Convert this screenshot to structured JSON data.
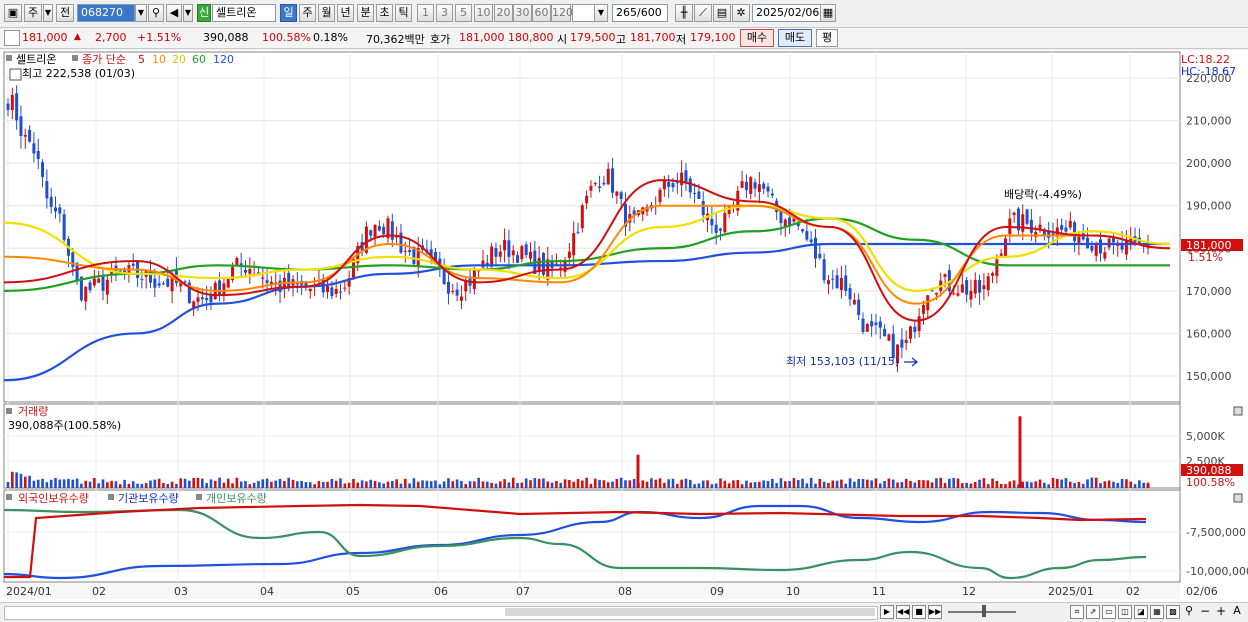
{
  "toolbar": {
    "market": "주",
    "prev_label": "전",
    "code": "068270",
    "stock_name": "셀트리온",
    "new_badge": "신",
    "periods": [
      "일",
      "주",
      "월",
      "년",
      "분",
      "초",
      "틱"
    ],
    "selected_period": "일",
    "intervals": [
      "1",
      "3",
      "5",
      "10",
      "20",
      "30",
      "60",
      "120"
    ],
    "count": "265",
    "count_max": "/600",
    "date": "2025/02/06"
  },
  "info_bar": {
    "price": "181,000",
    "change": "2,700",
    "change_pct": "+1.51%",
    "volume": "390,088",
    "volume_ratio": "100.58%",
    "turnover": "0.18%",
    "amount": "70,362백만",
    "ask_label": "호가",
    "ask_price": "181,000",
    "bid_price": "180,800",
    "open_label": "시",
    "open": "179,500",
    "high_label": "고",
    "high": "181,700",
    "low_label": "저",
    "low": "179,100",
    "buy_label": "매수",
    "sell_label": "매도",
    "eval_label": "평"
  },
  "legend": {
    "name": "셀트리온",
    "ma_label": "종가 단순",
    "ma_periods": [
      "5",
      "10",
      "20",
      "60",
      "120"
    ],
    "ma_colors": [
      "#d01010",
      "#ff8800",
      "#e8d800",
      "#20a020",
      "#2050e0"
    ],
    "high_note": "최고 222,538 (01/03)",
    "low_note": "최저 153,103 (11/15)",
    "dividend_note": "배당락(-4.49%)",
    "lc": "LC:18.22",
    "hc": "HC:-18.67",
    "price_tag": "181,000",
    "pct_tag": "1.51%"
  },
  "volume_panel": {
    "title": "거래량",
    "value_text": "390,088주(100.58%)",
    "tag": "390,088",
    "tag_pct": "100.58%"
  },
  "holding_panel": {
    "items": [
      "외국인보유수량",
      "기관보유수량",
      "개인보유수량"
    ]
  },
  "x_axis": {
    "labels": [
      "2024/01",
      "02",
      "03",
      "04",
      "05",
      "06",
      "07",
      "08",
      "09",
      "10",
      "11",
      "12",
      "2025/01",
      "02",
      "02/06"
    ]
  },
  "colors": {
    "up": "#d01010",
    "down": "#1f4fd0"
  },
  "chart_data": [
    {
      "type": "candlestick",
      "title": "셀트리온",
      "ylabels": [
        "220,000",
        "210,000",
        "200,000",
        "190,000",
        "180,000",
        "170,000",
        "160,000",
        "150,000"
      ],
      "ylim": [
        145000,
        223000
      ],
      "annotations": {
        "high": 222538,
        "high_date": "01/03",
        "low": 153103,
        "low_date": "11/15",
        "dividend": "-4.49%"
      },
      "series": [
        {
          "name": "5",
          "month_end_values": [
            172000,
            177000,
            169000,
            171000,
            183000,
            172000,
            175000,
            196000,
            191000,
            185000,
            163000,
            185000,
            183000,
            180000
          ]
        },
        {
          "name": "10",
          "month_end_values": [
            178000,
            175000,
            170000,
            172000,
            181000,
            173000,
            172000,
            190000,
            190000,
            185000,
            167000,
            183000,
            183000,
            180000
          ]
        },
        {
          "name": "20",
          "month_end_values": [
            186000,
            174000,
            173000,
            175000,
            178000,
            175000,
            173000,
            185000,
            190000,
            187000,
            170000,
            178000,
            184000,
            181000
          ]
        },
        {
          "name": "60",
          "month_end_values": [
            170000,
            174000,
            176000,
            175000,
            176000,
            175000,
            177000,
            180000,
            184000,
            187000,
            182000,
            176000,
            176000,
            176000
          ]
        },
        {
          "name": "120",
          "month_end_values": [
            149000,
            160000,
            167000,
            171000,
            174000,
            176000,
            176000,
            177000,
            179000,
            181000,
            181000,
            181000,
            181000,
            181000
          ]
        }
      ],
      "last_close": 181000
    },
    {
      "type": "bar",
      "title": "거래량",
      "ylabels": [
        "5,000K",
        "2,500K"
      ],
      "ylim": [
        0,
        7500000
      ],
      "spikes": [
        {
          "month": "08",
          "value": 3200000
        },
        {
          "month": "12",
          "value": 6900000
        }
      ],
      "typical_range": [
        350000,
        1000000
      ],
      "last": 390088
    },
    {
      "type": "line",
      "title": "외국인보유수량 / 기관보유수량 / 개인보유수량",
      "ylabels": [
        "-7,500,000",
        "-10,000,000"
      ],
      "series": [
        {
          "name": "외국인보유수량",
          "color": "#d01010"
        },
        {
          "name": "기관보유수량",
          "color": "#2050e0"
        },
        {
          "name": "개인보유수량",
          "color": "#3a9060"
        }
      ]
    }
  ]
}
